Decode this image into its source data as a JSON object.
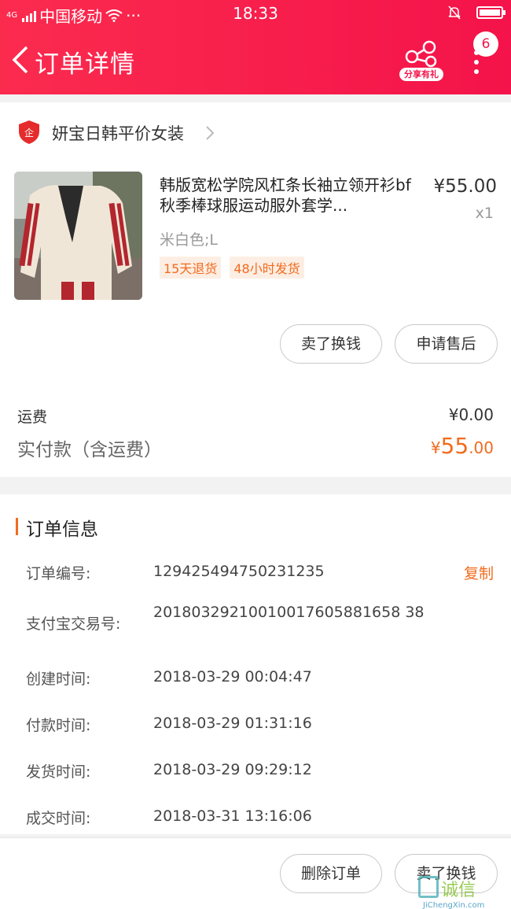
{
  "statusbar": {
    "network": "4G",
    "carrier": "中国移动",
    "dots": "···",
    "time": "18:33"
  },
  "header": {
    "title": "订单详情",
    "share_label": "分享有礼",
    "badge_count": "6"
  },
  "shop": {
    "name": "妍宝日韩平价女装",
    "icon_text": "企"
  },
  "product": {
    "title": "韩版宽松学院风杠条长袖立领开衫bf秋季棒球服运动服外套学...",
    "price": "¥55.00",
    "qty": "x1",
    "spec": "米白色;L",
    "tags": [
      "15天退货",
      "48小时发货"
    ]
  },
  "actions": {
    "sell": "卖了换钱",
    "after_sale": "申请售后"
  },
  "fees": {
    "shipping_label": "运费",
    "shipping_value": "¥0.00",
    "paid_label": "实付款（含运费）",
    "paid_currency": "¥",
    "paid_int": "55",
    "paid_dec": ".00"
  },
  "order_info": {
    "title": "订单信息",
    "copy_label": "复制",
    "rows": [
      {
        "label": "订单编号:",
        "value": "129425494750231235"
      },
      {
        "label": "支付宝交易号:",
        "value": "20180329210010017605881658 38"
      },
      {
        "label": "创建时间:",
        "value": "2018-03-29 00:04:47"
      },
      {
        "label": "付款时间:",
        "value": "2018-03-29 01:31:16"
      },
      {
        "label": "发货时间:",
        "value": "2018-03-29 09:29:12"
      },
      {
        "label": "成交时间:",
        "value": "2018-03-31 13:16:06"
      }
    ]
  },
  "bottom": {
    "delete": "删除订单",
    "sell": "卖了换钱"
  },
  "watermark": {
    "text": "诚信",
    "url": "JiChengXin.com"
  },
  "colors": {
    "header_red": "#f4134a",
    "accent_orange": "#f26b1d"
  }
}
